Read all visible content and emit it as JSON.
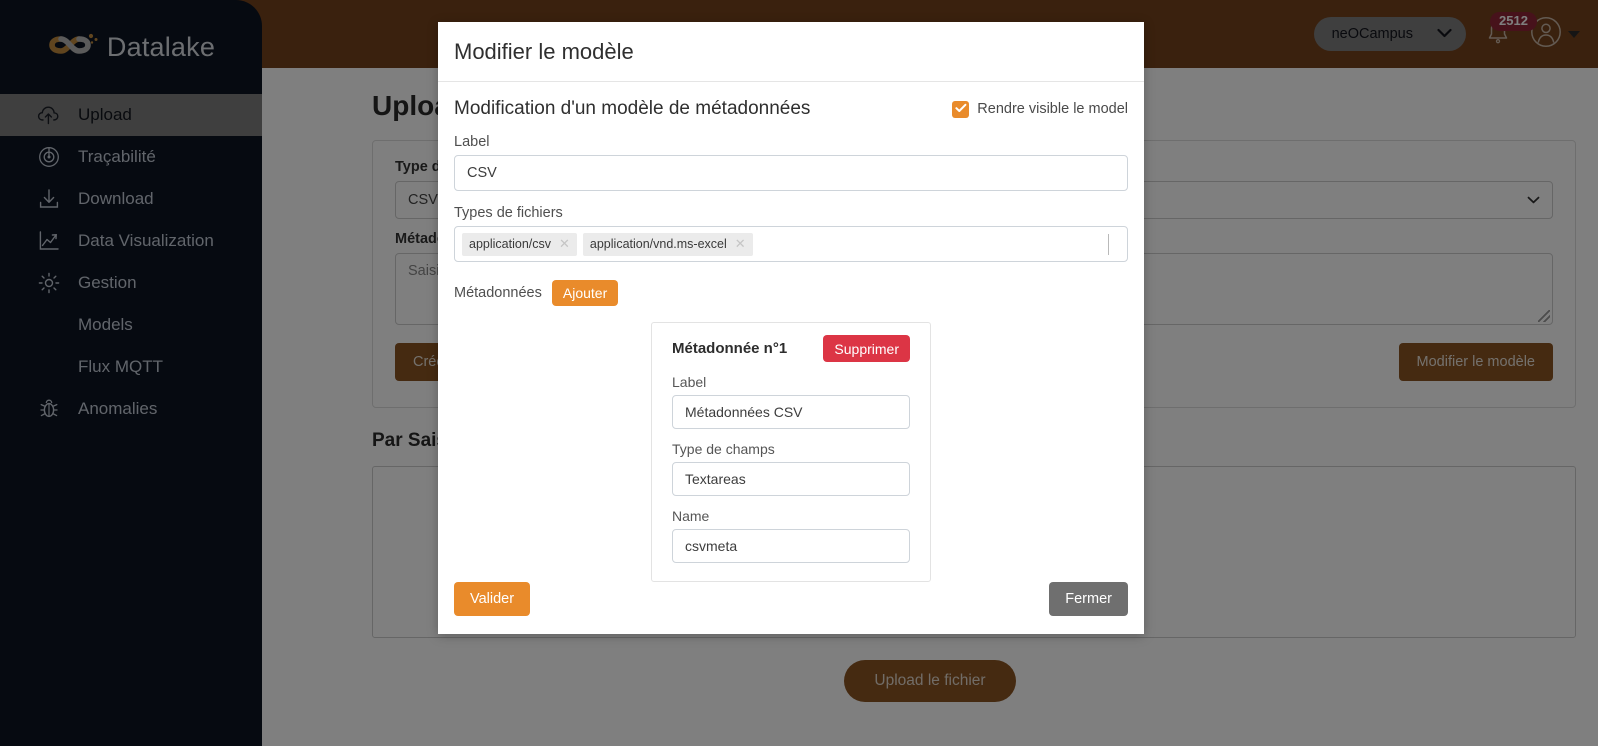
{
  "brand": {
    "name": "Datalake",
    "logo_icon": "infinity-logo-icon"
  },
  "colors": {
    "header_brown": "#74421d",
    "sidebar_dark": "#0d1522",
    "accent_orange": "#e98b2b",
    "danger_red": "#dc3545",
    "button_brown": "#8a5522",
    "badge_red": "#8f2437",
    "neutral_gray": "#6f6f6f"
  },
  "topbar": {
    "tenant": "neOCampus",
    "tenant_chevron_icon": "chevron-down-icon",
    "bell_icon": "bell-icon",
    "notification_count": "2512",
    "avatar_icon": "user-avatar-icon",
    "avatar_caret_icon": "caret-down-icon"
  },
  "sidebar": {
    "items": [
      {
        "label": "Upload",
        "icon": "cloud-upload-icon",
        "active": true,
        "sub": false
      },
      {
        "label": "Traçabilité",
        "icon": "radar-icon",
        "active": false,
        "sub": false
      },
      {
        "label": "Download",
        "icon": "download-icon",
        "active": false,
        "sub": false
      },
      {
        "label": "Data Visualization",
        "icon": "chart-line-icon",
        "active": false,
        "sub": false
      },
      {
        "label": "Gestion",
        "icon": "gear-icon",
        "active": false,
        "sub": false
      },
      {
        "label": "Models",
        "icon": "",
        "active": false,
        "sub": true
      },
      {
        "label": "Flux MQTT",
        "icon": "",
        "active": false,
        "sub": true
      },
      {
        "label": "Anomalies",
        "icon": "bug-icon",
        "active": false,
        "sub": false
      }
    ]
  },
  "page": {
    "title": "Upload",
    "type_label": "Type de fichier",
    "type_value": "CSV",
    "type_chevron_icon": "chevron-down-icon",
    "right_select_value": "",
    "right_select_chevron_icon": "chevron-down-icon",
    "meta_label": "Métadonnées",
    "meta_placeholder": "Saisissez vos métadonnées",
    "right_textarea_value": "",
    "create_button": "Créer un modèle",
    "edit_button": "Modifier le modèle",
    "section_title": "Par Saisie",
    "upload_button": "Upload le fichier"
  },
  "modal": {
    "title": "Modifier le modèle",
    "subtitle": "Modification d'un modèle de métadonnées",
    "visible_checkbox": {
      "label": "Rendre visible le model",
      "checked": true,
      "check_icon": "check-icon"
    },
    "label_field": {
      "label": "Label",
      "value": "CSV"
    },
    "filetypes_field": {
      "label": "Types de fichiers",
      "tags": [
        {
          "text": "application/csv",
          "remove_icon": "close-icon"
        },
        {
          "text": "application/vnd.ms-excel",
          "remove_icon": "close-icon"
        }
      ]
    },
    "metadata_section": {
      "label": "Métadonnées",
      "add_button": "Ajouter"
    },
    "metadata_cards": [
      {
        "title": "Métadonnée n°1",
        "delete_button": "Supprimer",
        "fields": [
          {
            "label": "Label",
            "value": "Métadonnées CSV"
          },
          {
            "label": "Type de champs",
            "value": "Textareas"
          },
          {
            "label": "Name",
            "value": "csvmeta"
          }
        ]
      }
    ],
    "footer": {
      "validate": "Valider",
      "close": "Fermer"
    }
  }
}
